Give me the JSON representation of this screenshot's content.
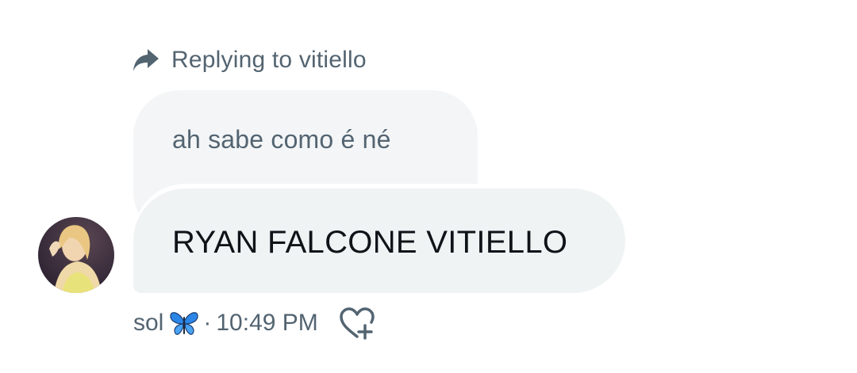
{
  "reply_context": {
    "text": "Replying to vitiello",
    "icon": "reply-arrow-icon"
  },
  "quoted_message": {
    "text": "ah sabe como é né"
  },
  "message": {
    "text": "RYAN FALCONE VITIELLO"
  },
  "sender": {
    "name": "sol",
    "emoji_icon": "butterfly-icon",
    "avatar": "user-avatar-photo"
  },
  "meta": {
    "separator": "·",
    "time": "10:49 PM"
  },
  "actions": {
    "react_icon": "heart-plus-icon"
  },
  "colors": {
    "secondary_text": "#536471",
    "primary_text": "#0f1419",
    "bubble_bg": "#eff3f4",
    "quoted_bubble_bg": "#f3f5f6",
    "butterfly_blue": "#1d6fe0"
  }
}
